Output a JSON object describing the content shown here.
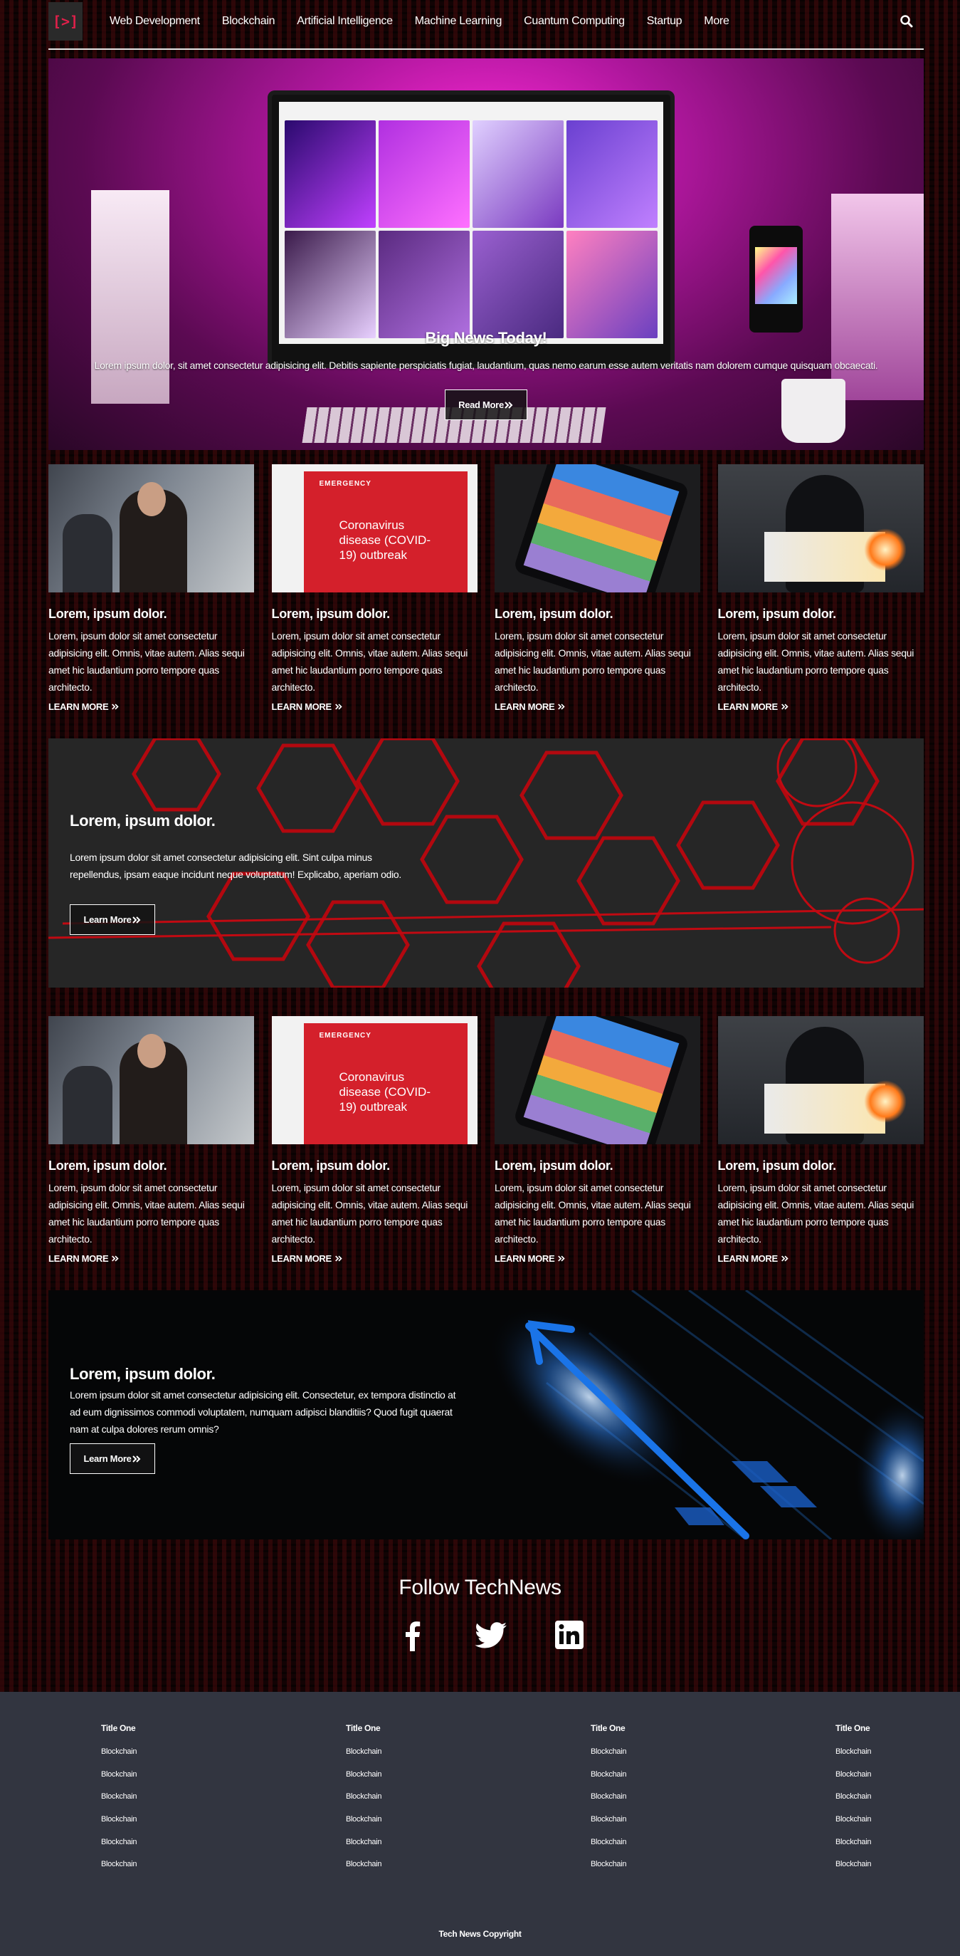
{
  "nav": {
    "logo": "[>]",
    "links": [
      "Web Development",
      "Blockchain",
      "Artificial Intelligence",
      "Machine Learning",
      "Cuantum Computing",
      "Startup",
      "More"
    ]
  },
  "hero": {
    "title": "Big News Today!",
    "text": "Lorem ipsum dolor, sit amet consectetur adipisicing elit. Debitis sapiente perspiciatis fugiat, laudantium, quas nemo earum esse autem veritatis nam dolorem cumque quisquam obcaecati.",
    "button": "Read More"
  },
  "cards_row1": [
    {
      "title": "Lorem, ipsum dolor.",
      "text": "Lorem, ipsum dolor sit amet consectetur adipisicing elit. Omnis, vitae autem. Alias sequi amet hic laudantium porro tempore quas architecto.",
      "link": "LEARN MORE"
    },
    {
      "title": "Lorem, ipsum dolor.",
      "text": "Lorem, ipsum dolor sit amet consectetur adipisicing elit. Omnis, vitae autem. Alias sequi amet hic laudantium porro tempore quas architecto.",
      "link": "LEARN MORE"
    },
    {
      "title": "Lorem, ipsum dolor.",
      "text": "Lorem, ipsum dolor sit amet consectetur adipisicing elit. Omnis, vitae autem. Alias sequi amet hic laudantium porro tempore quas architecto.",
      "link": "LEARN MORE"
    },
    {
      "title": "Lorem, ipsum dolor.",
      "text": "Lorem, ipsum dolor sit amet consectetur adipisicing elit. Omnis, vitae autem. Alias sequi amet hic laudantium porro tempore quas architecto.",
      "link": "LEARN MORE"
    }
  ],
  "cards_row2": [
    {
      "title": "Lorem, ipsum dolor.",
      "text": "Lorem, ipsum dolor sit amet consectetur adipisicing elit. Omnis, vitae autem. Alias sequi amet hic laudantium porro tempore quas architecto.",
      "link": "LEARN MORE"
    },
    {
      "title": "Lorem, ipsum dolor.",
      "text": "Lorem, ipsum dolor sit amet consectetur adipisicing elit. Omnis, vitae autem. Alias sequi amet hic laudantium porro tempore quas architecto.",
      "link": "LEARN MORE"
    },
    {
      "title": "Lorem, ipsum dolor.",
      "text": "Lorem, ipsum dolor sit amet consectetur adipisicing elit. Omnis, vitae autem. Alias sequi amet hic laudantium porro tempore quas architecto.",
      "link": "LEARN MORE"
    },
    {
      "title": "Lorem, ipsum dolor.",
      "text": "Lorem, ipsum dolor sit amet consectetur adipisicing elit. Omnis, vitae autem. Alias sequi amet hic laudantium porro tempore quas architecto.",
      "link": "LEARN MORE"
    }
  ],
  "card_images": {
    "emergency_label": "EMERGENCY",
    "emergency_text": "Coronavirus disease (COVID-19) outbreak"
  },
  "banner1": {
    "title": "Lorem, ipsum dolor.",
    "text": "Lorem ipsum dolor sit amet consectetur adipisicing elit. Sint culpa minus repellendus, ipsam eaque incidunt neque voluptatum! Explicabo, aperiam odio.",
    "button": "Learn More"
  },
  "banner2": {
    "title": "Lorem, ipsum dolor.",
    "text": "Lorem ipsum dolor sit amet consectetur adipisicing elit. Consectetur, ex tempora distinctio at ad eum dignissimos commodi voluptatem, numquam adipisci blanditiis? Quod fugit quaerat nam at culpa dolores rerum omnis?",
    "button": "Learn More"
  },
  "follow": {
    "title": "Follow TechNews",
    "icons": [
      "facebook-icon",
      "twitter-icon",
      "linkedin-icon"
    ]
  },
  "footer": {
    "columns": [
      {
        "title": "Title One",
        "items": [
          "Blockchain",
          "Blockchain",
          "Blockchain",
          "Blockchain",
          "Blockchain",
          "Blockchain"
        ]
      },
      {
        "title": "Title One",
        "items": [
          "Blockchain",
          "Blockchain",
          "Blockchain",
          "Blockchain",
          "Blockchain",
          "Blockchain"
        ]
      },
      {
        "title": "Title One",
        "items": [
          "Blockchain",
          "Blockchain",
          "Blockchain",
          "Blockchain",
          "Blockchain",
          "Blockchain"
        ]
      },
      {
        "title": "Title One",
        "items": [
          "Blockchain",
          "Blockchain",
          "Blockchain",
          "Blockchain",
          "Blockchain",
          "Blockchain"
        ]
      }
    ],
    "copyright": "Tech News Copyright"
  },
  "colors": {
    "logo_accent": "#e0204a",
    "footer_bg": "#323540",
    "banner_hex_red": "#b3080f",
    "banner_arrow_blue": "#1a74e8"
  }
}
